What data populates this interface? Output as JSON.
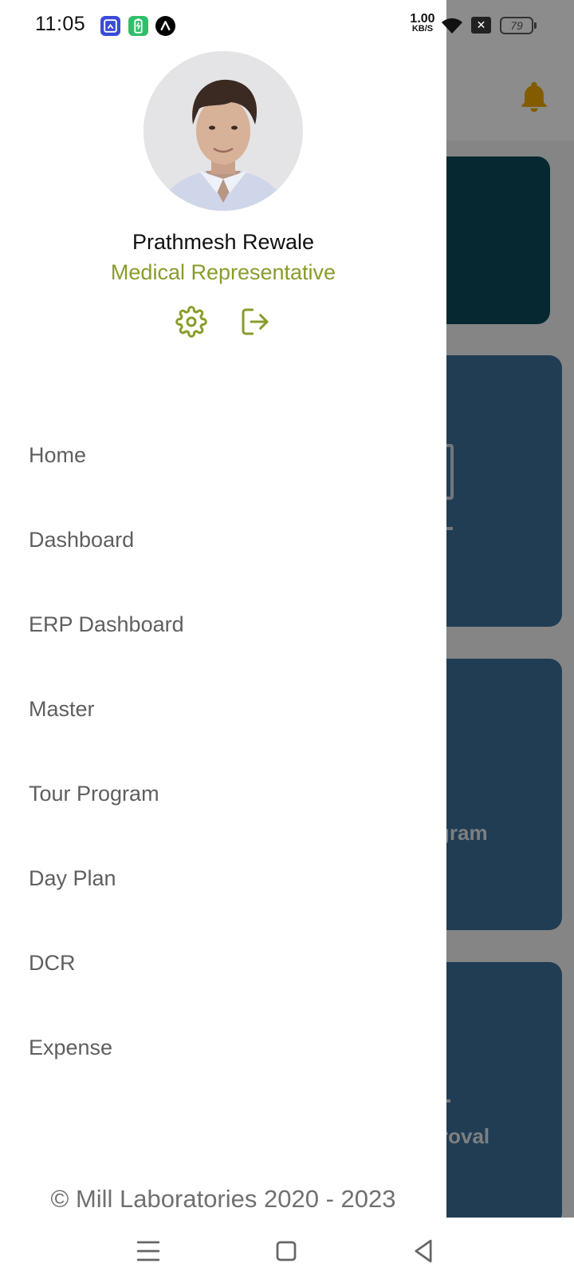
{
  "status_bar": {
    "time": "11:05",
    "network_speed": "1.00",
    "network_speed_unit": "KB/S",
    "battery_level": "79",
    "notification_icons": [
      "screen-mirror-icon",
      "battery-saver-icon",
      "triangle-app-icon"
    ]
  },
  "profile": {
    "name": "Prathmesh Rewale",
    "role": "Medical Representative"
  },
  "menu": {
    "items": [
      {
        "label": "Home"
      },
      {
        "label": "Dashboard"
      },
      {
        "label": "ERP Dashboard"
      },
      {
        "label": "Master"
      },
      {
        "label": "Tour Program"
      },
      {
        "label": "Day Plan"
      },
      {
        "label": "DCR"
      },
      {
        "label": "Expense"
      }
    ]
  },
  "footer": {
    "copyright": "© Mill Laboratories 2020 - 2023"
  },
  "background": {
    "card_labels": [
      "gram",
      "roval"
    ]
  },
  "colors": {
    "accent": "#8a9b2c",
    "bell": "#f0a800",
    "card": "#3b6f9a",
    "card_dark": "#0c4a5a"
  }
}
